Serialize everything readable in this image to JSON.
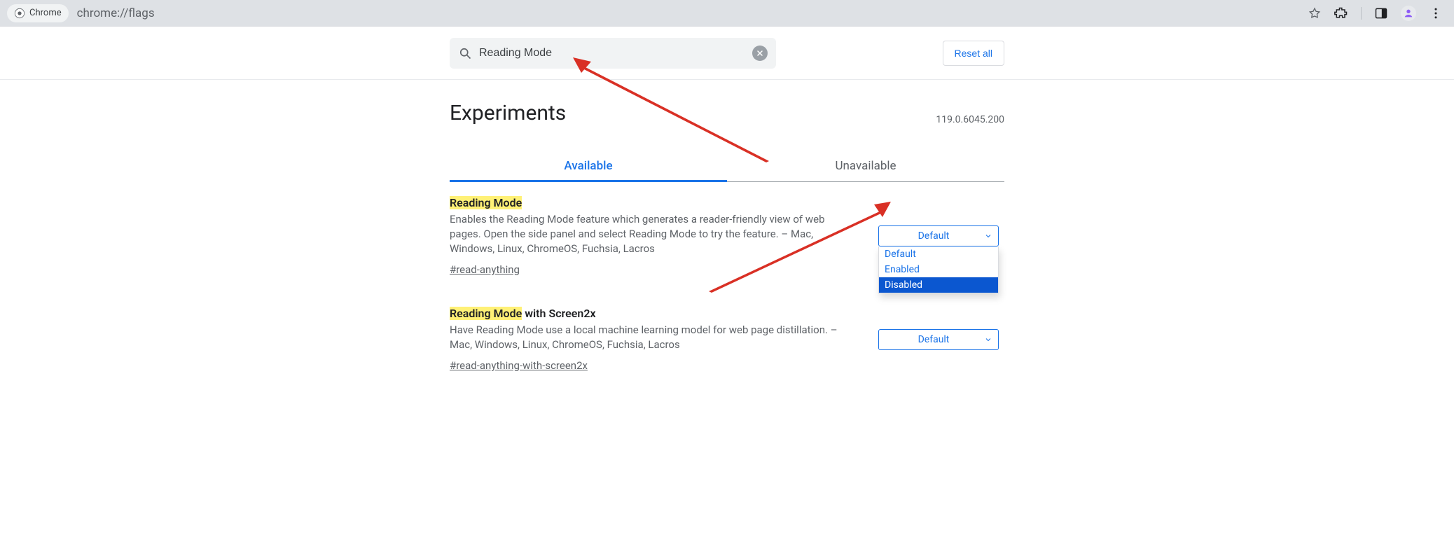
{
  "omnibox": {
    "chip": "Chrome",
    "url": "chrome://flags"
  },
  "toolbar": {
    "search_value": "Reading Mode",
    "reset_label": "Reset all"
  },
  "page": {
    "title": "Experiments",
    "version": "119.0.6045.200"
  },
  "tabs": {
    "available": "Available",
    "unavailable": "Unavailable"
  },
  "flags": [
    {
      "title_hl": "Reading Mode",
      "title_rest": "",
      "desc": "Enables the Reading Mode feature which generates a reader-friendly view of web pages. Open the side panel and select Reading Mode to try the feature. – Mac, Windows, Linux, ChromeOS, Fuchsia, Lacros",
      "hash": "#read-anything",
      "selected": "Default",
      "options": [
        "Default",
        "Enabled",
        "Disabled"
      ],
      "highlighted_option": "Disabled"
    },
    {
      "title_hl": "Reading Mode",
      "title_rest": " with Screen2x",
      "desc": "Have Reading Mode use a local machine learning model for web page distillation. – Mac, Windows, Linux, ChromeOS, Fuchsia, Lacros",
      "hash": "#read-anything-with-screen2x",
      "selected": "Default"
    }
  ]
}
